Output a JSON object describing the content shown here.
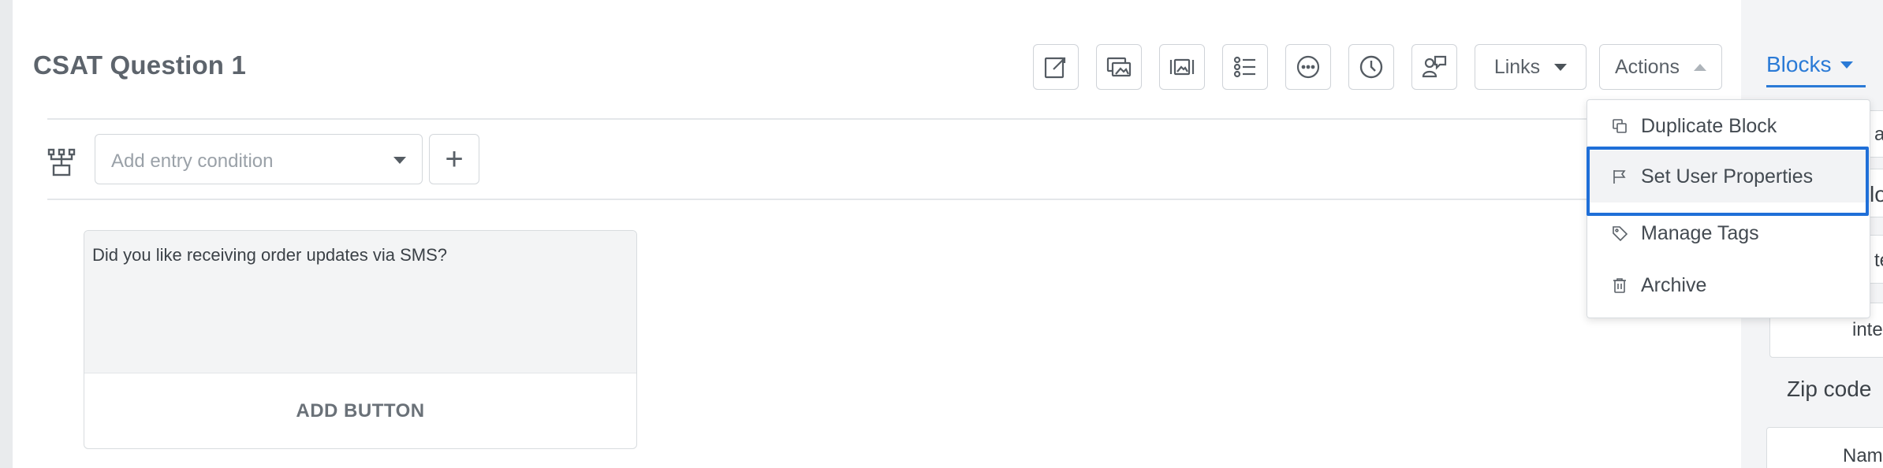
{
  "block": {
    "title": "CSAT Question 1"
  },
  "toolbar": {
    "icons": [
      "edit-message-icon",
      "gallery-icon",
      "media-icon",
      "list-icon",
      "typing-icon",
      "delay-icon",
      "user-input-icon"
    ],
    "links_label": "Links",
    "actions_label": "Actions"
  },
  "entry_condition": {
    "placeholder": "Add entry condition",
    "add_label": "+"
  },
  "card": {
    "text": "Did you like receiving order updates via SMS?",
    "add_button_label": "ADD BUTTON"
  },
  "actions_menu": {
    "items": [
      {
        "label": "Duplicate Block",
        "icon": "duplicate-icon"
      },
      {
        "label": "Set User Properties",
        "icon": "flag-icon",
        "highlighted": true
      },
      {
        "label": "Manage Tags",
        "icon": "tag-icon"
      },
      {
        "label": "Archive",
        "icon": "trash-icon"
      }
    ]
  },
  "right_panel": {
    "tab_label": "Blocks",
    "clipped": [
      "at",
      "lo",
      "te",
      "inte",
      "Nam"
    ],
    "section_label": "Zip code"
  },
  "colors": {
    "accent": "#2a7ad6",
    "focus": "#1f6fd8"
  }
}
